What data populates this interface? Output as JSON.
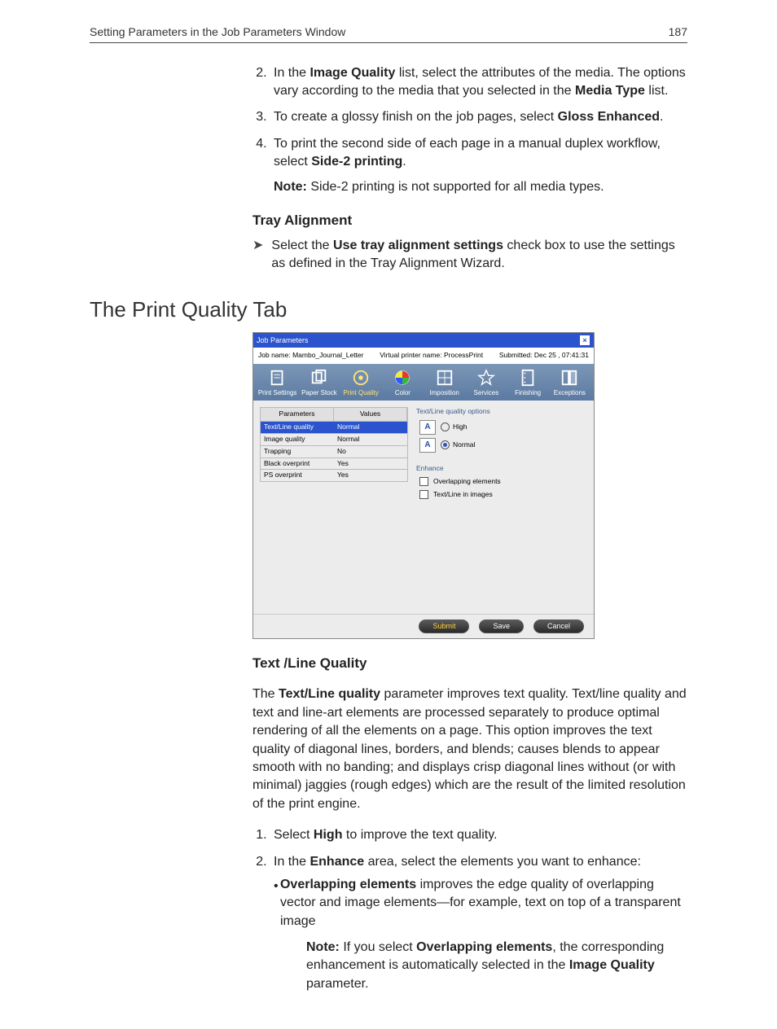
{
  "header": {
    "left": "Setting Parameters in the Job Parameters Window",
    "right": "187"
  },
  "step2": {
    "pre": "In the ",
    "b1": "Image Quality",
    "mid": " list, select the attributes of the media. The options vary according to the media that you selected in the ",
    "b2": "Media Type",
    "post": " list."
  },
  "step3": {
    "pre": "To create a glossy finish on the job pages, select ",
    "b": "Gloss Enhanced",
    "post": "."
  },
  "step4": {
    "pre": "To print the second side of each page in a manual duplex workflow, select ",
    "b": "Side-2 printing",
    "post": "."
  },
  "step4note": {
    "label": "Note:",
    "text": "  Side-2 printing is not supported for all media types."
  },
  "sub1": "Tray Alignment",
  "sub1item": {
    "pre": "Select the ",
    "b": "Use tray alignment settings",
    "post": " check box to use the settings as defined in the Tray Alignment Wizard."
  },
  "h1": "The Print Quality Tab",
  "dialog": {
    "title": "Job Parameters",
    "info": {
      "jobLabel": "Job name:",
      "jobVal": "Mambo_Journal_Letter",
      "vpLabel": "Virtual printer name:",
      "vpVal": "ProcessPrint",
      "subLabel": "Submitted:",
      "subVal": "Dec 25 , 07:41:31"
    },
    "tabs": [
      "Print Settings",
      "Paper Stock",
      "Print Quality",
      "Color",
      "Imposition",
      "Services",
      "Finishing",
      "Exceptions"
    ],
    "selTab": 2,
    "gridHdr": {
      "p": "Parameters",
      "v": "Values"
    },
    "rows": [
      {
        "p": "Text/Line quality",
        "v": "Normal",
        "sel": true
      },
      {
        "p": "Image quality",
        "v": "Normal"
      },
      {
        "p": "Trapping",
        "v": "No"
      },
      {
        "p": "Black overprint",
        "v": "Yes"
      },
      {
        "p": "PS overprint",
        "v": "Yes"
      }
    ],
    "rgroup": "Text/Line quality options",
    "optHigh": "High",
    "optNormal": "Normal",
    "egroup": "Enhance",
    "e1": "Overlapping elements",
    "e2": "Text/Line in images",
    "btnSubmit": "Submit",
    "btnSave": "Save",
    "btnCancel": "Cancel"
  },
  "sub2": "Text /Line Quality",
  "para2": {
    "pre": "The ",
    "b": "Text/Line quality",
    "post": " parameter improves text quality. Text/line quality and text and line-art elements are processed separately to produce optimal rendering of all the elements on a page. This option improves the text quality of diagonal lines, borders, and blends; causes blends to appear smooth with no banding; and displays crisp diagonal lines without (or with minimal) jaggies (rough edges) which are the result of the limited resolution of the print engine."
  },
  "q1": {
    "pre": "Select ",
    "b": "High",
    "post": " to improve the text quality."
  },
  "q2": {
    "pre": "In the ",
    "b": "Enhance",
    "post": " area, select the elements you want to enhance:"
  },
  "q2a": {
    "b": "Overlapping elements",
    "post": " improves the edge quality of overlapping vector and image elements—for example, text on top of a transparent image"
  },
  "q2note": {
    "label": "Note:",
    "pre": "  If you select ",
    "b1": "Overlapping elements",
    "mid": ", the corresponding enhancement is automatically selected in the ",
    "b2": "Image Quality",
    "post": " parameter."
  }
}
